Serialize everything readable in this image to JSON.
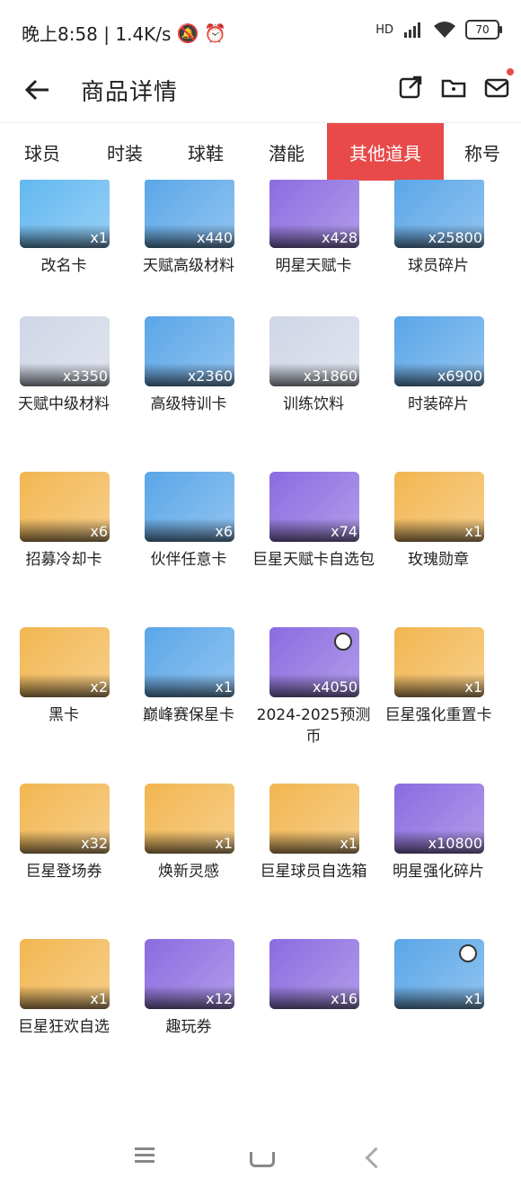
{
  "status_bar": {
    "time_speed": "晚上8:58 | 1.4K/s",
    "network": "HD",
    "battery": "70"
  },
  "header": {
    "title": "商品详情"
  },
  "tabs": [
    "球员",
    "时装",
    "球鞋",
    "潜能",
    "其他道具",
    "称号"
  ],
  "active_tab": "其他道具",
  "items": [
    {
      "name": "改名卡",
      "qty": "x1",
      "bg": "#62b8f0"
    },
    {
      "name": "天赋高级材料",
      "qty": "x440",
      "bg": "#5aa6e8"
    },
    {
      "name": "明星天赋卡",
      "qty": "x428",
      "bg": "#8b6be0"
    },
    {
      "name": "球员碎片",
      "qty": "x25800",
      "bg": "#5aa6e8"
    },
    {
      "name": "天赋中级材料",
      "qty": "x3350",
      "bg": "#cfd6e6"
    },
    {
      "name": "高级特训卡",
      "qty": "x2360",
      "bg": "#5aa6e8"
    },
    {
      "name": "训练饮料",
      "qty": "x31860",
      "bg": "#cfd6e6"
    },
    {
      "name": "时装碎片",
      "qty": "x6900",
      "bg": "#5aa6e8"
    },
    {
      "name": "招募冷却卡",
      "qty": "x6",
      "bg": "#f2b650"
    },
    {
      "name": "伙伴任意卡",
      "qty": "x6",
      "bg": "#5aa6e8"
    },
    {
      "name": "巨星天赋卡自选包",
      "qty": "x74",
      "bg": "#8b6be0"
    },
    {
      "name": "玫瑰勋章",
      "qty": "x1",
      "bg": "#f2b650"
    },
    {
      "name": "黑卡",
      "qty": "x2",
      "bg": "#f2b650"
    },
    {
      "name": "巅峰赛保星卡",
      "qty": "x1",
      "bg": "#5aa6e8"
    },
    {
      "name": "2024-2025预测币",
      "qty": "x4050",
      "bg": "#8b6be0",
      "timer": true
    },
    {
      "name": "巨星强化重置卡",
      "qty": "x1",
      "bg": "#f2b650"
    },
    {
      "name": "巨星登场券",
      "qty": "x32",
      "bg": "#f2b650"
    },
    {
      "name": "焕新灵感",
      "qty": "x1",
      "bg": "#f2b650"
    },
    {
      "name": "巨星球员自选箱",
      "qty": "x1",
      "bg": "#f2b650"
    },
    {
      "name": "明星强化碎片",
      "qty": "x10800",
      "bg": "#8b6be0"
    },
    {
      "name": "巨星狂欢自选",
      "qty": "x1",
      "bg": "#f2b650"
    },
    {
      "name": "趣玩券",
      "qty": "x12",
      "bg": "#8b6be0"
    },
    {
      "name": "",
      "qty": "x16",
      "bg": "#8b6be0"
    },
    {
      "name": "",
      "qty": "x1",
      "bg": "#5aa6e8",
      "timer": true
    }
  ]
}
